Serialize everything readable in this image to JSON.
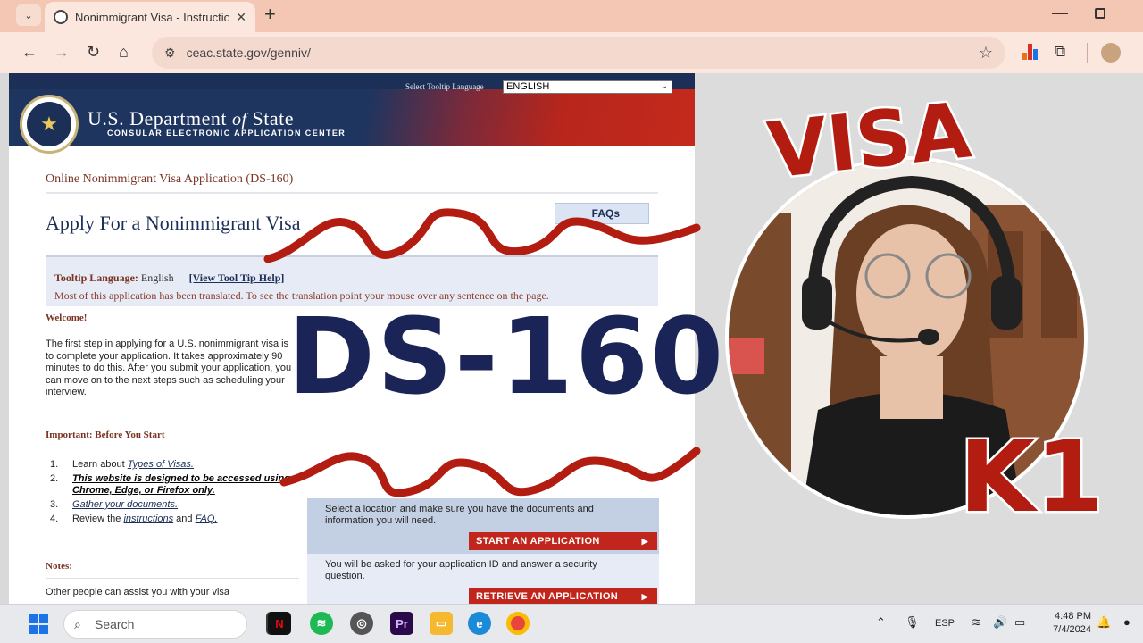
{
  "browser": {
    "tab_title": "Nonimmigrant Visa - Instructions",
    "url": "ceac.state.gov/genniv/"
  },
  "site_header": {
    "dept_pre": "U.S. Department ",
    "dept_of": "of",
    "dept_post": " State",
    "center": "CONSULAR ELECTRONIC APPLICATION CENTER",
    "tooltip_language_label": "Select Tooltip Language",
    "tooltip_language_value": "ENGLISH"
  },
  "main": {
    "breadcrumb_title": "Online Nonimmigrant Visa Application (DS-160)",
    "page_title": "Apply For a Nonimmigrant Visa",
    "faqs_label": "FAQs",
    "tooltip_label": "Tooltip Language:",
    "tooltip_value": "English",
    "view_tooltip_help": "[View Tool Tip Help]",
    "translation_note": "Most of this application has been translated. To see the translation point your mouse over any sentence on the page.",
    "welcome_heading": "Welcome!",
    "welcome_text": "The first step in applying for a U.S. nonimmigrant visa is to complete your application. It takes approximately 90 minutes to do this. After you submit your application, you can move on to the next steps such as scheduling your interview.",
    "important_heading": "Important: Before You Start",
    "steps": [
      {
        "num": "1.",
        "pre": "Learn about ",
        "link": "Types of Visas."
      },
      {
        "num": "2.",
        "bold": "This website is designed to be accessed using Chrome, Edge, or Firefox only."
      },
      {
        "num": "3.",
        "link": "Gather your documents."
      },
      {
        "num": "4.",
        "pre": "Review the ",
        "link": "instructions",
        "mid": " and ",
        "link2": "FAQ."
      }
    ],
    "notes_heading": "Notes:",
    "notes_text": "Other people can assist you with your visa",
    "start_text": "Select a location and make sure you have the documents and information you will need.",
    "start_button": "START AN APPLICATION",
    "retrieve_text": "You will be asked for your application ID and answer a security question.",
    "retrieve_button": "RETRIEVE AN APPLICATION"
  },
  "overlay": {
    "ds160": "DS-160",
    "visa": "VISA",
    "k1": "K1"
  },
  "taskbar": {
    "search_placeholder": "Search",
    "lang": "ESP",
    "time": "4:48 PM",
    "date": "7/4/2024"
  }
}
